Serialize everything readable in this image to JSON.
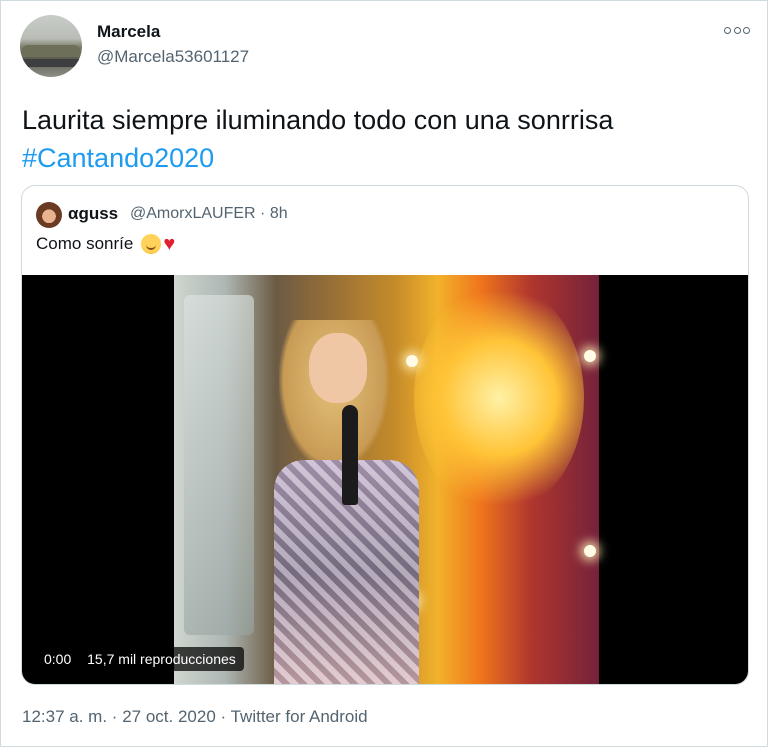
{
  "tweet": {
    "author_name": "Marcela",
    "author_handle": "@Marcela53601127",
    "text": "Laurita siempre iluminando todo con una sonrrisa",
    "hashtag": "#Cantando2020",
    "more_icon": "more-options-icon",
    "footer": {
      "time": "12:37 a. m.",
      "separator": "·",
      "date": "27 oct. 2020",
      "source": "Twitter for Android"
    }
  },
  "quote": {
    "author_name": "αguss",
    "author_handle": "@AmorxLAUFER",
    "separator": "·",
    "age": "8h",
    "text": "Como sonríe",
    "emojis": [
      "smiling-face-emoji",
      "red-heart-emoji"
    ],
    "video": {
      "time": "0:00",
      "views": "15,7 mil reproducciones"
    }
  },
  "colors": {
    "text": "#0f1419",
    "secondary": "#536471",
    "link": "#1d9bf0",
    "border": "#cfd9de"
  }
}
